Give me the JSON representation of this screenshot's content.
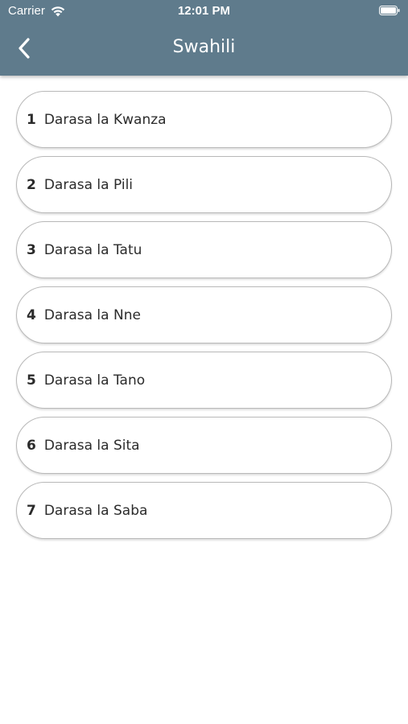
{
  "status_bar": {
    "carrier": "Carrier",
    "time": "12:01 PM",
    "icons": [
      "wifi-icon",
      "battery-icon"
    ]
  },
  "nav": {
    "title": "Swahili",
    "back_icon": "chevron-left-icon",
    "background_color": "#5f7b8c"
  },
  "list": {
    "items": [
      {
        "number": "1",
        "label": "Darasa la Kwanza"
      },
      {
        "number": "2",
        "label": "Darasa la Pili"
      },
      {
        "number": "3",
        "label": "Darasa la Tatu"
      },
      {
        "number": "4",
        "label": "Darasa la Nne"
      },
      {
        "number": "5",
        "label": "Darasa la Tano"
      },
      {
        "number": "6",
        "label": "Darasa la Sita"
      },
      {
        "number": "7",
        "label": "Darasa la Saba"
      }
    ]
  }
}
